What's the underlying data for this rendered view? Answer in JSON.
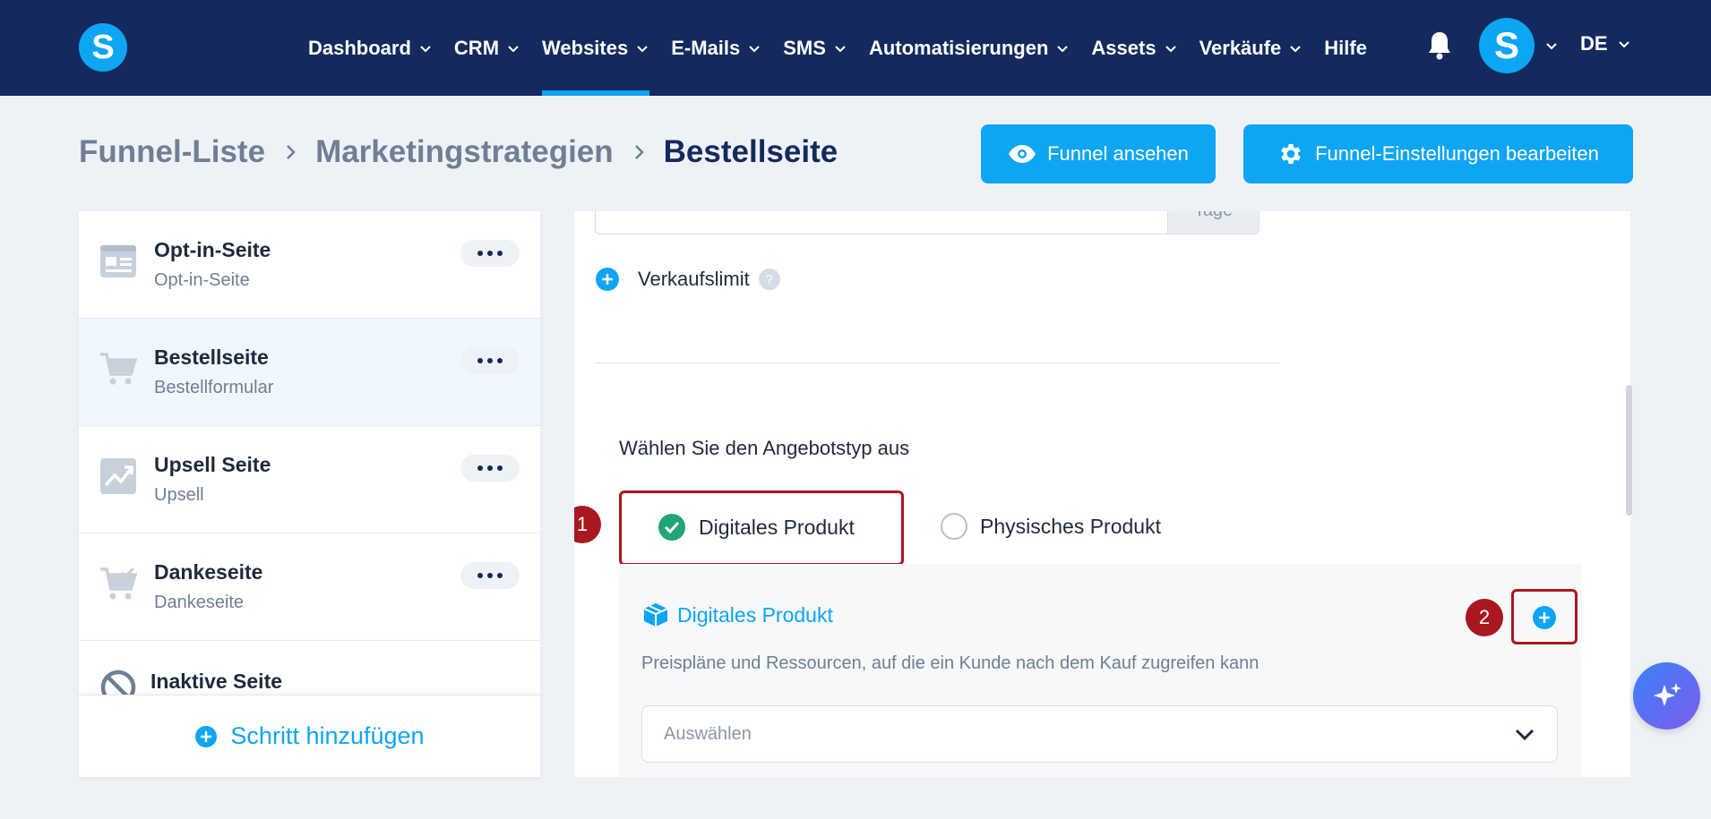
{
  "app": {
    "logo_letter": "S",
    "avatar_letter": "S",
    "language": "DE"
  },
  "nav": {
    "items": [
      {
        "label": "Dashboard"
      },
      {
        "label": "CRM"
      },
      {
        "label": "Websites"
      },
      {
        "label": "E-Mails"
      },
      {
        "label": "SMS"
      },
      {
        "label": "Automatisierungen"
      },
      {
        "label": "Assets"
      },
      {
        "label": "Verkäufe"
      },
      {
        "label": "Hilfe"
      }
    ],
    "active": "Websites"
  },
  "breadcrumb": {
    "items": [
      "Funnel-Liste",
      "Marketingstrategien"
    ],
    "current": "Bestellseite"
  },
  "actions": {
    "view_funnel": "Funnel ansehen",
    "edit_settings": "Funnel-Einstellungen bearbeiten"
  },
  "sidebar": {
    "steps": [
      {
        "title": "Opt-in-Seite",
        "subtitle": "Opt-in-Seite",
        "icon": "form-page-icon"
      },
      {
        "title": "Bestellseite",
        "subtitle": "Bestellformular",
        "icon": "cart-icon"
      },
      {
        "title": "Upsell Seite",
        "subtitle": "Upsell",
        "icon": "trending-up-icon"
      },
      {
        "title": "Dankeseite",
        "subtitle": "Dankeseite",
        "icon": "cart-check-icon"
      }
    ],
    "inactive_label": "Inaktive Seite",
    "add_step": "Schritt hinzufügen"
  },
  "main": {
    "days_addon": "Tage",
    "sales_limit": "Verkaufslimit",
    "help_glyph": "?",
    "offer_type_label": "Wählen Sie den Angebotstyp aus",
    "offer_types": [
      "Digitales Produkt",
      "Physisches Produkt"
    ],
    "selected_offer_type": "Digitales Produkt",
    "product_section": {
      "title": "Digitales Produkt",
      "description": "Preispläne und Ressourcen, auf die ein Kunde nach dem Kauf zugreifen kann",
      "select_placeholder": "Auswählen"
    }
  },
  "annotations": {
    "badge1": "1",
    "badge2": "2"
  },
  "colors": {
    "nav_bg": "#142a5e",
    "accent": "#0ea5f3",
    "annotation": "#a8181e",
    "check": "#22a37a"
  }
}
